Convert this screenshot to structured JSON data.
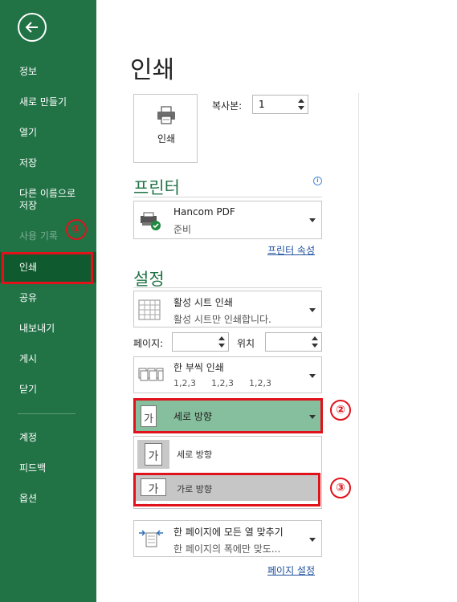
{
  "sidebar": {
    "items": [
      {
        "label": "정보"
      },
      {
        "label": "새로 만들기"
      },
      {
        "label": "열기"
      },
      {
        "label": "저장"
      },
      {
        "label": "다른 이름으로\n저장"
      },
      {
        "label": "사용 기록"
      },
      {
        "label": "인쇄"
      },
      {
        "label": "공유"
      },
      {
        "label": "내보내기"
      },
      {
        "label": "게시"
      },
      {
        "label": "닫기"
      },
      {
        "label": "계정"
      },
      {
        "label": "피드백"
      },
      {
        "label": "옵션"
      }
    ]
  },
  "annotations": {
    "step1": "①",
    "step2": "②",
    "step3": "③"
  },
  "main": {
    "title": "인쇄",
    "print_button": "인쇄",
    "copies_label": "복사본:",
    "copies_value": "1",
    "printer_section": "프린터",
    "printer_name": "Hancom PDF",
    "printer_status": "준비",
    "printer_properties": "프린터 속성",
    "settings_section": "설정",
    "print_what_title": "활성 시트 인쇄",
    "print_what_desc": "활성 시트만 인쇄합니다.",
    "pages_label": "페이지:",
    "to_label": "위치",
    "collate_title": "한 부씩 인쇄",
    "collate_desc": [
      "1,2,3",
      "1,2,3",
      "1,2,3"
    ],
    "orientation_selected": "세로 방향",
    "orientation_options": [
      "세로 방향",
      "가로 방향"
    ],
    "hidden_partial": "···· ·· ····",
    "scaling_title": "한 페이지에 모든 열 맞추기",
    "scaling_desc": "한 페이지의 폭에만 맞도...",
    "page_setup": "페이지 설정",
    "icon_glyph": "가"
  },
  "colors": {
    "sidebar": "#217346",
    "accent": "#217346",
    "highlight": "#e0121b",
    "selected": "#86bf9d"
  }
}
